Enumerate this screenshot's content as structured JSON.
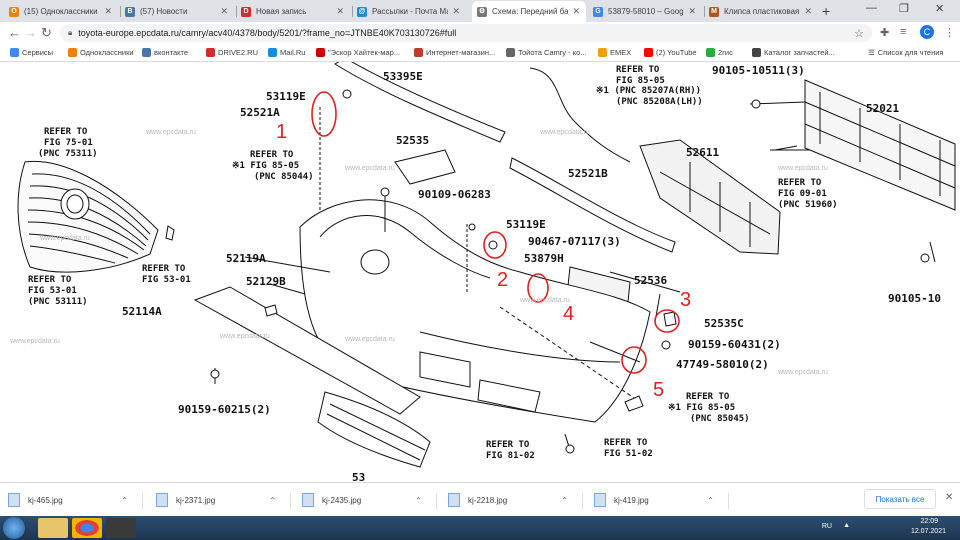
{
  "tabs": [
    {
      "title": "(15) Одноклассники",
      "icon": "odnoklassniki-icon",
      "color": "#ee8208",
      "glyph": "О"
    },
    {
      "title": "(57) Новости",
      "icon": "vk-icon",
      "color": "#4a76a8",
      "glyph": "В"
    },
    {
      "title": "Новая запись",
      "icon": "drive2-icon",
      "color": "#d22b2b",
      "glyph": "D"
    },
    {
      "title": "Рассылки - Почта Ма",
      "icon": "mail-icon",
      "color": "#168de2",
      "glyph": "@"
    },
    {
      "title": "Схема: Передний бам",
      "icon": "epc-gear-icon",
      "color": "#777777",
      "glyph": "⚙"
    },
    {
      "title": "53879-58010 – Google",
      "icon": "google-icon",
      "color": "#4285f4",
      "glyph": "G"
    },
    {
      "title": "Клипса пластиковая",
      "icon": "shop-icon",
      "color": "#b5541b",
      "glyph": "M"
    }
  ],
  "active_tab": 4,
  "toolbar": {
    "url": "toyota-europe.epcdata.ru/camry/acv40/4378/body/5201/?frame_no=JTNBE40K703130726#full",
    "account_initial": "C"
  },
  "bookmarks": [
    {
      "label": "Сервисы",
      "icon": "apps-grid-icon",
      "color": "#4285f4"
    },
    {
      "label": "Одноклассники",
      "icon": "odnoklassniki-icon",
      "color": "#ee8208"
    },
    {
      "label": "вконтакте",
      "icon": "vk-icon",
      "color": "#4a76a8"
    },
    {
      "label": "DRIVE2.RU",
      "icon": "drive2-icon",
      "color": "#d22b2b"
    },
    {
      "label": "Mail.Ru",
      "icon": "mail-icon",
      "color": "#168de2"
    },
    {
      "label": "\"Эскор Хайтек-мар...",
      "icon": "red-dot-icon",
      "color": "#cc0000"
    },
    {
      "label": "Интернет-магазин...",
      "icon": "shop-icon",
      "color": "#c0392b"
    },
    {
      "label": "Тойота Camry - ко...",
      "icon": "gear-icon",
      "color": "#666666"
    },
    {
      "label": "EMEX",
      "icon": "emex-icon",
      "color": "#f39c12"
    },
    {
      "label": "(2) YouTube",
      "icon": "youtube-icon",
      "color": "#ff0000"
    },
    {
      "label": "2гис",
      "icon": "2gis-icon",
      "color": "#2eaa3e"
    },
    {
      "label": "Каталог запчастей...",
      "icon": "catalog-icon",
      "color": "#444444"
    }
  ],
  "reading_list": "Список для чтения",
  "diagram": {
    "labels": [
      "53119E",
      "52521A",
      "53395E",
      "52535",
      "90109-06283",
      "52521B",
      "52611",
      "90105-10511(3)",
      "52021",
      "53119E",
      "90467-07117(3)",
      "53879H",
      "52119A",
      "52129B",
      "52114A",
      "52536",
      "52535C",
      "90159-60431(2)",
      "47749-58010(2)",
      "90159-60215(2)",
      "90105-10"
    ],
    "refers": [
      [
        "REFER TO",
        "FIG 75-01",
        "(PNC 75311)"
      ],
      [
        "REFER TO",
        "※1 FIG 85-05",
        "(PNC 85044)"
      ],
      [
        "REFER TO",
        "FIG 85-05",
        "※1 (PNC 85207A(RH))",
        "(PNC 85208A(LH))"
      ],
      [
        "REFER TO",
        "FIG 09-01",
        "(PNC 51960)"
      ],
      [
        "REFER TO",
        "FIG 53-01"
      ],
      [
        "REFER TO",
        "FIG 53-01",
        "(PNC 53111)"
      ],
      [
        "REFER TO",
        "※1 FIG 85-05",
        "(PNC 85045)"
      ],
      [
        "REFER TO",
        "FIG 81-02"
      ],
      [
        "REFER TO",
        "FIG 51-02"
      ]
    ],
    "partial_label": "53",
    "watermark": "www.epcdata.ru",
    "annotations": [
      "1",
      "2",
      "3",
      "4",
      "5"
    ]
  },
  "downloads": [
    {
      "name": "kj-465.jpg"
    },
    {
      "name": "kj-2371.jpg"
    },
    {
      "name": "kj-2435.jpg"
    },
    {
      "name": "kj-2218.jpg"
    },
    {
      "name": "kj-419.jpg"
    }
  ],
  "show_all": "Показать все",
  "taskbar": {
    "lang": "RU",
    "time": "22:09",
    "date": "12.07.2021"
  }
}
